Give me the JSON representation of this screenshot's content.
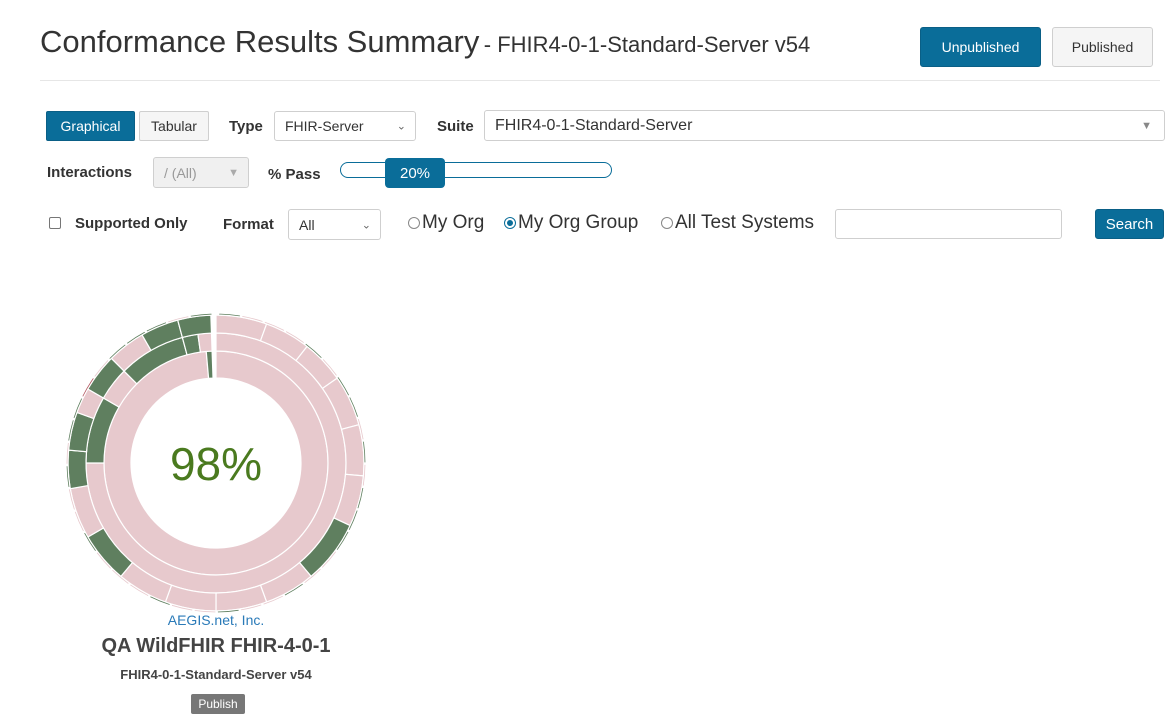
{
  "header": {
    "title": "Conformance Results Summary",
    "subtitle": "- FHIR4-0-1-Standard-Server v54",
    "unpublished_label": "Unpublished",
    "published_label": "Published"
  },
  "view_toggle": {
    "graphical": "Graphical",
    "tabular": "Tabular",
    "active": "Graphical"
  },
  "filters": {
    "type_label": "Type",
    "type_value": "FHIR-Server",
    "suite_label": "Suite",
    "suite_value": "FHIR4-0-1-Standard-Server",
    "interactions_label": "Interactions",
    "interactions_value": "/ (All)",
    "pass_label": "% Pass",
    "pass_value": "20%",
    "pass_fraction": 0.2,
    "supported_only_label": "Supported Only",
    "supported_only_checked": false,
    "format_label": "Format",
    "format_value": "All",
    "scope_options": [
      "My Org",
      "My Org Group",
      "All Test Systems"
    ],
    "scope_selected": "My Org Group",
    "search_value": "",
    "search_button": "Search"
  },
  "colors": {
    "accent": "#0a6d99",
    "pass": "#5f7f5f",
    "fail": "#b2565f",
    "untested": "#e7c9cd",
    "score_text": "#4a7a1f"
  },
  "results": [
    {
      "score": "98%",
      "organization": "AEGIS.net, Inc.",
      "system": "QA WildFHIR FHIR-4-0-1",
      "suite": "FHIR4-0-1-Standard-Server v54",
      "publish_label": "Publish"
    }
  ]
}
